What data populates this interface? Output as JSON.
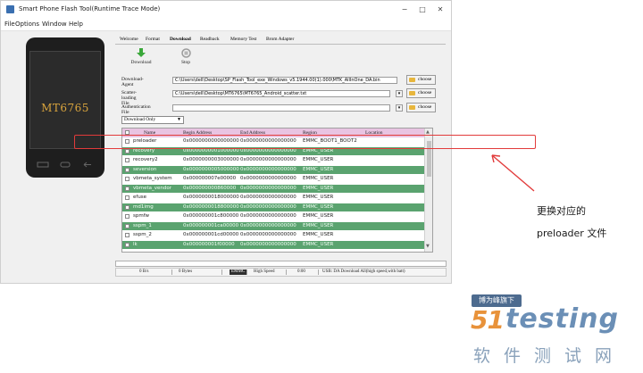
{
  "window": {
    "title": "Smart Phone Flash Tool(Runtime Trace Mode)",
    "controls": {
      "minimize": "−",
      "maximize": "□",
      "close": "✕"
    }
  },
  "menu": [
    "File",
    "Options",
    "Window",
    "Help"
  ],
  "phone": {
    "model": "MT6765"
  },
  "tabs": [
    "Welcome",
    "Format",
    "Download",
    "Readback",
    "Memory Test",
    "Brom Adapter"
  ],
  "active_tab": "Download",
  "toolbar": {
    "download_label": "Download",
    "stop_label": "Stop"
  },
  "fields": {
    "download_agent": {
      "label": "Download-Agent",
      "value": "C:\\Users\\dell\\Desktop\\SP_Flash_Tool_exe_Windows_v5.1944.00(1).000\\MTK_AllInOne_DA.bin"
    },
    "scatter_file": {
      "label": "Scatter-loading File",
      "value": "C:\\Users\\dell\\Desktop\\MT6765\\MT6765_Android_scatter.txt"
    },
    "auth_file": {
      "label": "Authentication File",
      "value": ""
    },
    "choose_label": "choose"
  },
  "mode": {
    "selected": "Download Only"
  },
  "table": {
    "headers": [
      "Name",
      "Begin Address",
      "End Address",
      "Region",
      "Location"
    ],
    "rows": [
      {
        "name": "preloader",
        "begin": "0x0000000000000000",
        "end": "0x0000000000000000",
        "region": "EMMC_BOOT1_BOOT2",
        "green": false
      },
      {
        "name": "recovery",
        "begin": "0x0000000001000000",
        "end": "0x0000000000000000",
        "region": "EMMC_USER",
        "green": true
      },
      {
        "name": "recovery2",
        "begin": "0x0000000003000000",
        "end": "0x0000000000000000",
        "region": "EMMC_USER",
        "green": false
      },
      {
        "name": "seversion",
        "begin": "0x0000000005000000",
        "end": "0x0000000000000000",
        "region": "EMMC_USER",
        "green": true
      },
      {
        "name": "vbmeta_system",
        "begin": "0x000000007e00000",
        "end": "0x0000000000000000",
        "region": "EMMC_USER",
        "green": false
      },
      {
        "name": "vbmeta_vendor",
        "begin": "0x000000000860000",
        "end": "0x0000000000000000",
        "region": "EMMC_USER",
        "green": true
      },
      {
        "name": "efuse",
        "begin": "0x0000000018000000",
        "end": "0x0000000000000000",
        "region": "EMMC_USER",
        "green": false
      },
      {
        "name": "md1img",
        "begin": "0x0000000018800000",
        "end": "0x0000000000000000",
        "region": "EMMC_USER",
        "green": true
      },
      {
        "name": "spmfw",
        "begin": "0x000000001c800000",
        "end": "0x0000000000000000",
        "region": "EMMC_USER",
        "green": false
      },
      {
        "name": "sspm_1",
        "begin": "0x000000001ca00000",
        "end": "0x0000000000000000",
        "region": "EMMC_USER",
        "green": true
      },
      {
        "name": "sspm_2",
        "begin": "0x000000001cd00000",
        "end": "0x0000000000000000",
        "region": "EMMC_USER",
        "green": false
      },
      {
        "name": "lk",
        "begin": "0x000000001f00000",
        "end": "0x0000000000000000",
        "region": "EMMC_USER",
        "green": true
      }
    ]
  },
  "status": {
    "speed": "0 B/s",
    "bytes": "0 Bytes",
    "port": "EMMC",
    "mode": "High Speed",
    "time": "0:00",
    "info": "USB: DA Download All(high speed,with batt)"
  },
  "annotation": {
    "line1": "更换对应的",
    "line2": "preloader 文件"
  },
  "watermark": {
    "badge": "博为峰旗下",
    "brand_num": "51",
    "brand_word": "testing",
    "cn": "软件测试网"
  }
}
